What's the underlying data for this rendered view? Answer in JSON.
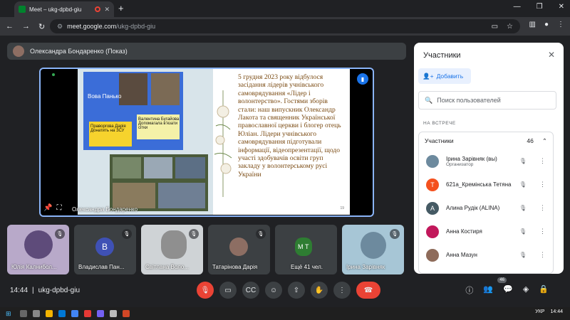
{
  "browser": {
    "tab_title": "Meet – ukg-dpbd-giu",
    "url_host": "meet.google.com",
    "url_path": "/ukg-dpbd-giu"
  },
  "presenter": {
    "label": "Олександра Бондаренко (Показ)"
  },
  "stage": {
    "name": "Олександра Бондаренко",
    "slide_text": "5 грудня 2023 року відбулося засідання лідерів учнівського самоврядування «Лідер і волонтерство». Гостями  зборів стали: наш випускник Олександр Лакота та священник Української православної церкви і блогер отець Юліан. Лідери учнівського самоврядування підготували інформації, відеопрезентації, щодо участі здобувачів освіти груп закладу у волонтерському русі України",
    "collage_labels": [
      "Вова Панько",
      "Праворгова Дарія Донатить на ЗСУ",
      "Валентина Бугайова Допомагала в'язати сітки"
    ],
    "slide_page": "19"
  },
  "tiles": [
    {
      "name": "Юлія Калнибол...",
      "initial": "",
      "color": "#7b5ea7"
    },
    {
      "name": "Владислав Пан...",
      "initial": "В",
      "color": "#3f51b5"
    },
    {
      "name": "Світлана Воло...",
      "initial": "",
      "color": "#9e9e9e"
    },
    {
      "name": "Татарінова Дарія",
      "initial": "",
      "color": "#8d6e63"
    },
    {
      "name": "Ещё 41 чел.",
      "initial": "М Т",
      "color": "#2e7d32"
    },
    {
      "name": "Ірина Зарівняк",
      "initial": "",
      "color": "#6d8a9e"
    }
  ],
  "meeting": {
    "time": "14:44",
    "code": "ukg-dpbd-giu",
    "participants_badge": "46"
  },
  "panel": {
    "title": "Участники",
    "add_label": "Добавить",
    "search_placeholder": "Поиск пользователей",
    "section": "НА ВСТРЕЧЕ",
    "group_label": "Участники",
    "group_count": "46",
    "people": [
      {
        "name": "Ірина Зарівняк (вы)",
        "sub": "Организатор",
        "initial": "",
        "color": "#6d8a9e"
      },
      {
        "name": "621а_Кремінська Тетяна",
        "sub": "",
        "initial": "Т",
        "color": "#f4511e"
      },
      {
        "name": "Алина Рудік (ALINA)",
        "sub": "",
        "initial": "А",
        "color": "#455a64"
      },
      {
        "name": "Анна Костиря",
        "sub": "",
        "initial": "",
        "color": "#c2185b"
      },
      {
        "name": "Анна Мазун",
        "sub": "",
        "initial": "",
        "color": "#8e6b5a"
      }
    ]
  },
  "taskbar": {
    "lang": "УКР",
    "time": "14:44"
  }
}
